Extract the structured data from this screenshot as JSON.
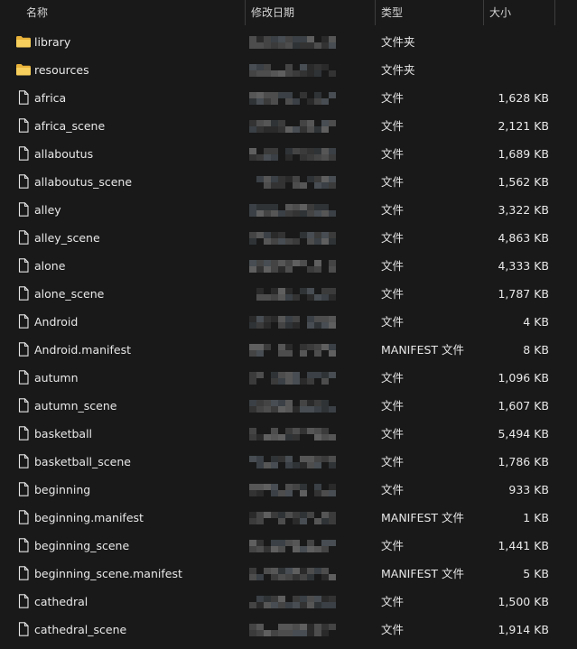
{
  "header": {
    "columns": {
      "name": "名称",
      "modified": "修改日期",
      "type": "类型",
      "size": "大小"
    },
    "sort_indicator": "ascending"
  },
  "colors": {
    "background": "#191919",
    "folder": "#f4c542",
    "text": "#e8e8e8",
    "separator": "#3c3c3c"
  },
  "files": [
    {
      "name": "library",
      "type": "文件夹",
      "size": "",
      "icon": "folder-icon"
    },
    {
      "name": "resources",
      "type": "文件夹",
      "size": "",
      "icon": "folder-icon"
    },
    {
      "name": "africa",
      "type": "文件",
      "size": "1,628 KB",
      "icon": "file-icon"
    },
    {
      "name": "africa_scene",
      "type": "文件",
      "size": "2,121 KB",
      "icon": "file-icon"
    },
    {
      "name": "allaboutus",
      "type": "文件",
      "size": "1,689 KB",
      "icon": "file-icon"
    },
    {
      "name": "allaboutus_scene",
      "type": "文件",
      "size": "1,562 KB",
      "icon": "file-icon"
    },
    {
      "name": "alley",
      "type": "文件",
      "size": "3,322 KB",
      "icon": "file-icon"
    },
    {
      "name": "alley_scene",
      "type": "文件",
      "size": "4,863 KB",
      "icon": "file-icon"
    },
    {
      "name": "alone",
      "type": "文件",
      "size": "4,333 KB",
      "icon": "file-icon"
    },
    {
      "name": "alone_scene",
      "type": "文件",
      "size": "1,787 KB",
      "icon": "file-icon"
    },
    {
      "name": "Android",
      "type": "文件",
      "size": "4 KB",
      "icon": "file-icon"
    },
    {
      "name": "Android.manifest",
      "type": "MANIFEST 文件",
      "size": "8 KB",
      "icon": "file-icon"
    },
    {
      "name": "autumn",
      "type": "文件",
      "size": "1,096 KB",
      "icon": "file-icon"
    },
    {
      "name": "autumn_scene",
      "type": "文件",
      "size": "1,607 KB",
      "icon": "file-icon"
    },
    {
      "name": "basketball",
      "type": "文件",
      "size": "5,494 KB",
      "icon": "file-icon"
    },
    {
      "name": "basketball_scene",
      "type": "文件",
      "size": "1,786 KB",
      "icon": "file-icon"
    },
    {
      "name": "beginning",
      "type": "文件",
      "size": "933 KB",
      "icon": "file-icon"
    },
    {
      "name": "beginning.manifest",
      "type": "MANIFEST 文件",
      "size": "1 KB",
      "icon": "file-icon"
    },
    {
      "name": "beginning_scene",
      "type": "文件",
      "size": "1,441 KB",
      "icon": "file-icon"
    },
    {
      "name": "beginning_scene.manifest",
      "type": "MANIFEST 文件",
      "size": "5 KB",
      "icon": "file-icon"
    },
    {
      "name": "cathedral",
      "type": "文件",
      "size": "1,500 KB",
      "icon": "file-icon"
    },
    {
      "name": "cathedral_scene",
      "type": "文件",
      "size": "1,914 KB",
      "icon": "file-icon"
    }
  ]
}
